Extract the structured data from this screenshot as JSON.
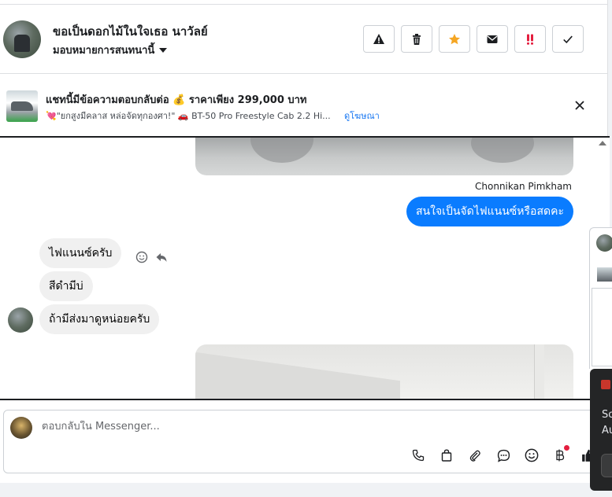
{
  "header": {
    "contact_name": "ขอเป็นดอกไม้ในใจเธอ นาวัลย์",
    "assign_label": "มอบหมายการสนทนานี้",
    "actions": [
      {
        "icon": "warning-icon"
      },
      {
        "icon": "trash-icon"
      },
      {
        "icon": "star-icon",
        "color": "#f5a623"
      },
      {
        "icon": "mail-icon"
      },
      {
        "icon": "double-exclamation-icon",
        "color": "#e41e3f"
      },
      {
        "icon": "check-icon"
      }
    ]
  },
  "ad": {
    "title": "แชทนี้มีข้อความตอบกลับต่อ 💰 ราคาเพียง 299,000 บาท",
    "subtitle": "💘\"ยกสูงมีคลาส หล่อจัดทุกองศา!\" 🚗 BT-50 Pro Freestyle Cab 2.2 Hi...",
    "link": "ดูโฆษณา"
  },
  "chat": {
    "outgoing_sender": "Chonnikan Pimkham",
    "outgoing_message": "สนใจเป็นจัดไฟแนนซ์หรือสดคะ",
    "incoming_messages": [
      "ไฟแนนซ์ครับ",
      "สีดำมีบ่",
      "ถ้ามีส่งมาดูหน่อยครับ"
    ]
  },
  "composer": {
    "placeholder": "ตอบกลับใน Messenger...",
    "tools": [
      "phone-icon",
      "shopping-bag-icon",
      "paperclip-icon",
      "chat-bubble-icon",
      "emoji-icon",
      "baht-icon",
      "thumbs-up-icon"
    ]
  },
  "popup": {
    "text_line1": "So",
    "text_line2": "Au"
  },
  "colors": {
    "accent": "#0a7cff",
    "link": "#1877f2",
    "star": "#f5a623",
    "alert": "#e41e3f"
  }
}
